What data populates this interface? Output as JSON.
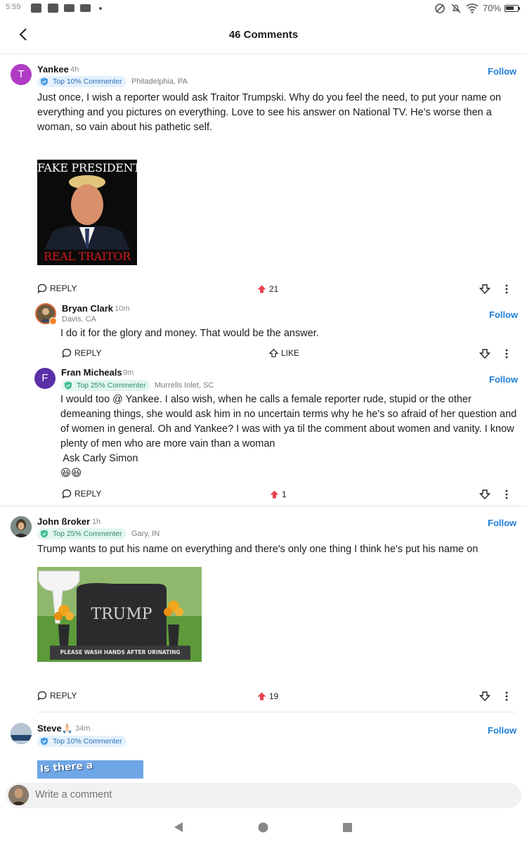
{
  "status_bar": {
    "time": "5:59",
    "battery": "70%"
  },
  "header": {
    "title": "46 Comments"
  },
  "comments": [
    {
      "avatar_letter": "T",
      "avatar_color": "#b03cc4",
      "name": "Yankee",
      "time": "4h",
      "badge": "Top 10% Commenter",
      "location": "Philadelphia, PA",
      "follow": "Follow",
      "text": "Just once, I wish a reporter would ask Traitor Trumpski. Why do you feel the need, to put your name on everything and you pictures on everything. Love to see his answer on National TV. He's worse then a woman, so vain about his pathetic self.",
      "image_top": "FAKE PRESIDENT",
      "image_bottom": "REAL TRAITOR",
      "reply": "REPLY",
      "votes": "21"
    },
    {
      "name": "Bryan Clark",
      "time": "10m",
      "location": "Davis, CA",
      "follow": "Follow",
      "text": "I do it for the glory and money. That would be the answer.",
      "reply": "REPLY",
      "like": "LIKE"
    },
    {
      "avatar_letter": "F",
      "avatar_color": "#5b2fa8",
      "name": "Fran Micheals",
      "time": "9m",
      "badge": "Top 25% Commenter",
      "location": "Murrells Inlet, SC",
      "follow": "Follow",
      "text_lines": [
        "I would too @ Yankee. I also wish, when he calls a female reporter rude, stupid or the other demeaning things, she would ask him in no uncertain terms why he he's so afraid of her question and of women in general. Oh and Yankee? I was with ya til the comment about women and vanity. I know plenty of men who are more vain than a woman",
        " Ask Carly Simon",
        "😆😆"
      ],
      "reply": "REPLY",
      "votes": "1"
    },
    {
      "name": "John ßroker",
      "time": "1h",
      "badge": "Top 25% Commenter",
      "location": "Gary, IN",
      "follow": "Follow",
      "text": "Trump wants to put his name on everything and there's only one thing I think he's put his name on",
      "image_headstone": "TRUMP",
      "image_caption": "PLEASE WASH HANDS AFTER URINATING",
      "reply": "REPLY",
      "votes": "19"
    },
    {
      "name": "Steve🙏🏻",
      "time": "34m",
      "badge": "Top 10% Commenter",
      "follow": "Follow",
      "image_text": "Is there a"
    }
  ],
  "composer": {
    "placeholder": "Write a comment"
  },
  "colors": {
    "accent": "#1e7fd6",
    "upvote": "#e8414a",
    "blue_badge_bg": "#e4f1fd",
    "green_badge_bg": "#e2f6ef"
  }
}
